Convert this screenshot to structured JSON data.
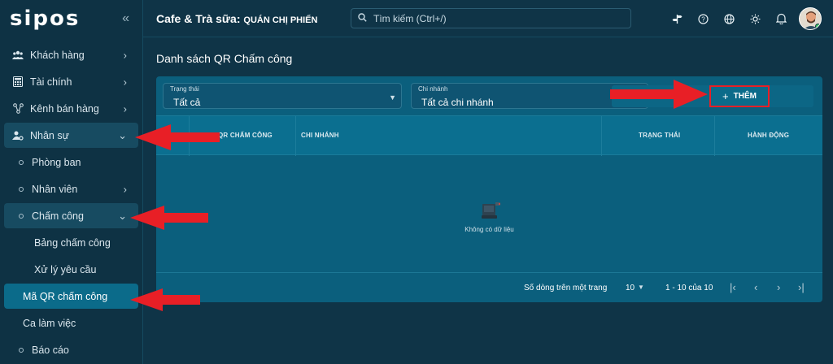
{
  "app": {
    "logo": "sipos"
  },
  "sidebar": {
    "items": [
      {
        "label": "Khách hàng"
      },
      {
        "label": "Tài chính"
      },
      {
        "label": "Kênh bán hàng"
      },
      {
        "label": "Nhân sự"
      },
      {
        "label": "Phòng ban"
      },
      {
        "label": "Nhân viên"
      },
      {
        "label": "Chấm công"
      },
      {
        "label": "Bảng chấm công"
      },
      {
        "label": "Xử lý yêu cầu"
      },
      {
        "label": "Mã QR chấm công"
      },
      {
        "label": "Ca làm việc"
      },
      {
        "label": "Báo cáo"
      }
    ]
  },
  "header": {
    "title": "Cafe & Trà sữa: ",
    "shop": "QUÁN CHỊ PHIẾN",
    "search_placeholder": "Tìm kiếm (Ctrl+/)"
  },
  "main": {
    "page_title": "Danh sách QR Chấm công",
    "filters": {
      "status_label": "Trạng thái",
      "status_value": "Tất cả",
      "branch_label": "Chi nhánh",
      "branch_value": "Tất cả chi nhánh"
    },
    "add_label": "THÊM",
    "columns": [
      "QR CHẤM CÔNG",
      "CHI NHÁNH",
      "TRẠNG THÁI",
      "HÀNH ĐỘNG"
    ],
    "empty_text": "Không có dữ liệu",
    "pagination": {
      "rows_label": "Số dòng trên một trang",
      "rows_value": "10",
      "range": "1 - 10 của 10"
    }
  },
  "colors": {
    "background": "#0f3447",
    "card": "#0b5f7d",
    "active": "#0b6b8a",
    "annotation": "#e81f26"
  }
}
